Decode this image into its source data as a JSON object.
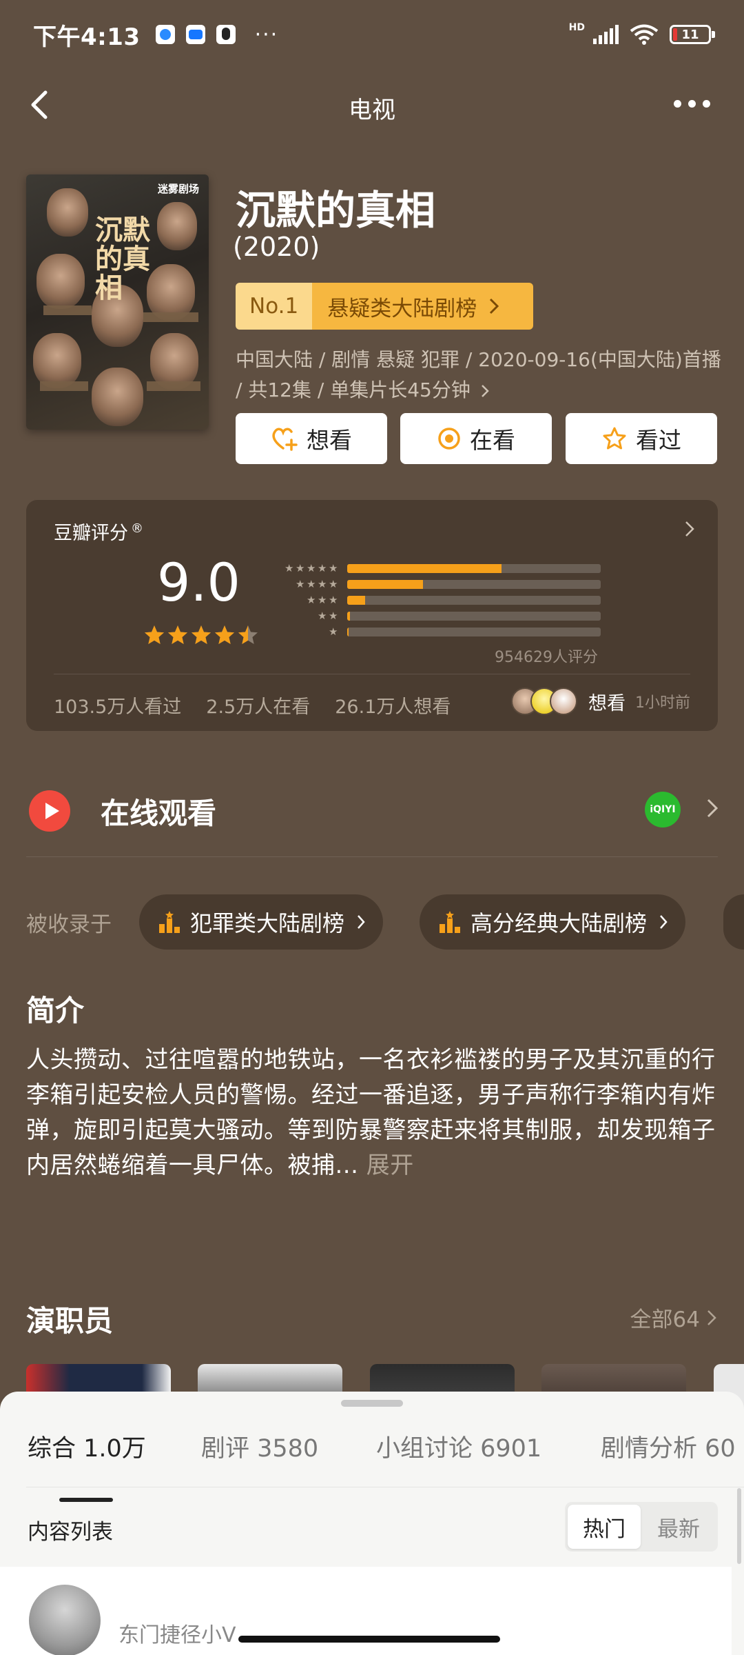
{
  "status_bar": {
    "time": "下午4:13",
    "more": "···",
    "hd": "HD",
    "battery": "11"
  },
  "nav": {
    "title": "电视"
  },
  "movie": {
    "poster_logo": "迷雾剧场",
    "poster_title": "沉默的真相",
    "title": "沉默的真相",
    "year": "(2020)",
    "rank_no": "No.1",
    "rank_name": "悬疑类大陆剧榜",
    "meta": "中国大陆 / 剧情 悬疑 犯罪 / 2020-09-16(中国大陆)首播 / 共12集 / 单集片长45分钟"
  },
  "actions": {
    "want": "想看",
    "watching": "在看",
    "watched": "看过"
  },
  "rating": {
    "label": "豆瓣评分",
    "registered": "®",
    "score": "9.0",
    "stars": 4.5,
    "distribution": [
      0.61,
      0.3,
      0.07,
      0.01,
      0.005
    ],
    "count": "954629人评分",
    "watched": "103.5万人看过",
    "watching": "2.5万人在看",
    "want": "26.1万人想看",
    "friends_action": "想看",
    "friends_time": "1小时前",
    "colors": {
      "bar": "#f6a01a",
      "star": "#f6a01a"
    }
  },
  "watch": {
    "title": "在线观看",
    "provider_icon": "iqiyi-icon",
    "provider_text": "iQIYI"
  },
  "included": {
    "label": "被收录于",
    "lists": [
      "犯罪类大陆剧榜",
      "高分经典大陆剧榜"
    ]
  },
  "intro": {
    "heading": "简介",
    "text": "人头攒动、过往喧嚣的地铁站，一名衣衫褴褛的男子及其沉重的行李箱引起安检人员的警惕。经过一番追逐，男子声称行李箱内有炸弹，旋即引起莫大骚动。等到防暴警察赶来将其制服，却发现箱子内居然蜷缩着一具尸体。被捕...",
    "expand": "展开"
  },
  "cast": {
    "heading": "演职员",
    "all": "全部64"
  },
  "sheet": {
    "tabs": [
      "综合 1.0万",
      "剧评 3580",
      "小组讨论 6901",
      "剧情分析 60"
    ],
    "list_label": "内容列表",
    "sort_hot": "热门",
    "sort_latest": "最新",
    "first_user": "东门捷径小V"
  }
}
